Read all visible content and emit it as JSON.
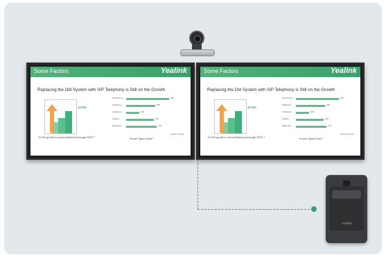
{
  "scene": {
    "background": "#e3e8ec",
    "accent": "#3d9d74"
  },
  "slide": {
    "section": "Some Factors",
    "brand": "Yealink",
    "title": "Replacing the Old System with SIP Telephony is Still on the Growth",
    "growth_value": "12.5%",
    "growth_caption": "\"12.5% growth in cloud telephony through 2015\" ¹",
    "phone_types": [
      {
        "label": "Desk Phones",
        "value": "66%",
        "fraction": 0.66
      },
      {
        "label": "Softphones",
        "value": "45%",
        "fraction": 0.45
      },
      {
        "label": "Conference",
        "value": "20%",
        "fraction": 0.2
      },
      {
        "label": "Headset",
        "value": "43%",
        "fraction": 0.43
      },
      {
        "label": "Mobile App",
        "value": "47%",
        "fraction": 0.47
      }
    ],
    "phone_axis": "Percent of sample",
    "phone_caption": "Phone Types Used ²"
  },
  "hub": {
    "brand": "Yealink"
  },
  "icons": [
    "camera-icon",
    "hub-device-icon"
  ]
}
